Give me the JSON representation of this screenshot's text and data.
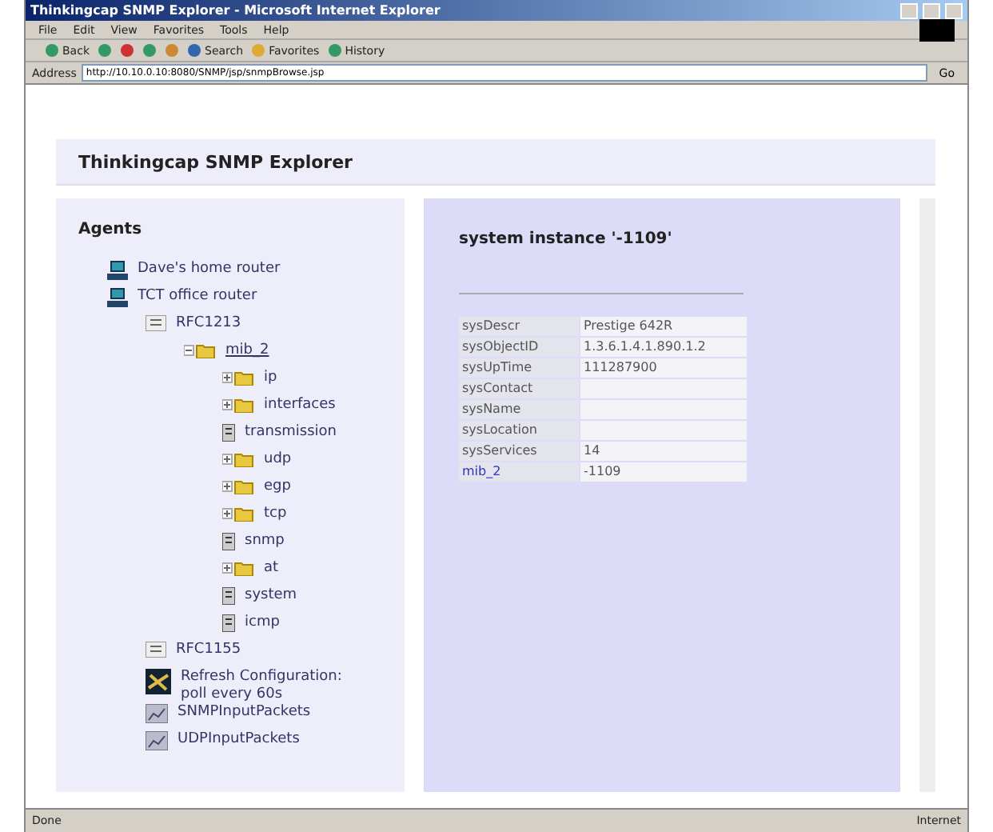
{
  "window": {
    "title": "Thinkingcap SNMP Explorer - Microsoft Internet Explorer"
  },
  "menu": [
    "File",
    "Edit",
    "View",
    "Favorites",
    "Tools",
    "Help"
  ],
  "toolbar": [
    {
      "kind": "back",
      "label": "Back"
    },
    {
      "kind": "forward"
    },
    {
      "kind": "stop"
    },
    {
      "kind": "refresh"
    },
    {
      "kind": "home"
    },
    {
      "kind": "search",
      "label": "Search"
    },
    {
      "kind": "favorites",
      "label": "Favorites"
    },
    {
      "kind": "history",
      "label": "History"
    }
  ],
  "address": {
    "label": "Address",
    "value": "http://10.10.0.10:8080/SNMP/jsp/snmpBrowse.jsp",
    "go": "Go"
  },
  "header": {
    "title": "Thinkingcap SNMP Explorer"
  },
  "agents": {
    "title": "Agents",
    "tree": [
      {
        "kind": "agent",
        "label": "Dave's home router"
      },
      {
        "kind": "agent",
        "label": "TCT office router",
        "children": [
          {
            "kind": "mib",
            "label": "RFC1213",
            "children": [
              {
                "kind": "folder",
                "label": "mib_2",
                "expanded": true,
                "children": [
                  {
                    "kind": "folder",
                    "label": "ip",
                    "expanded": false
                  },
                  {
                    "kind": "folder",
                    "label": "interfaces",
                    "expanded": false
                  },
                  {
                    "kind": "leaf",
                    "label": "transmission"
                  },
                  {
                    "kind": "folder",
                    "label": "udp",
                    "expanded": false
                  },
                  {
                    "kind": "folder",
                    "label": "egp",
                    "expanded": false
                  },
                  {
                    "kind": "folder",
                    "label": "tcp",
                    "expanded": false
                  },
                  {
                    "kind": "leaf",
                    "label": "snmp"
                  },
                  {
                    "kind": "folder",
                    "label": "at",
                    "expanded": false
                  },
                  {
                    "kind": "leaf",
                    "label": "system"
                  },
                  {
                    "kind": "leaf",
                    "label": "icmp"
                  }
                ]
              }
            ]
          },
          {
            "kind": "mib",
            "label": "RFC1155"
          },
          {
            "kind": "action",
            "label": "Refresh Configuration: poll every 60s"
          },
          {
            "kind": "graph",
            "label": "SNMPInputPackets"
          },
          {
            "kind": "graph",
            "label": "UDPInputPackets"
          }
        ]
      }
    ]
  },
  "detail": {
    "title": "system instance '-1109'",
    "rows": [
      {
        "name": "sysDescr",
        "value": "Prestige 642R",
        "link": false
      },
      {
        "name": "sysObjectID",
        "value": "1.3.6.1.4.1.890.1.2",
        "link": false
      },
      {
        "name": "sysUpTime",
        "value": "111287900",
        "link": false
      },
      {
        "name": "sysContact",
        "value": "",
        "link": false
      },
      {
        "name": "sysName",
        "value": "",
        "link": false
      },
      {
        "name": "sysLocation",
        "value": "",
        "link": false
      },
      {
        "name": "sysServices",
        "value": "14",
        "link": false
      },
      {
        "name": "mib_2",
        "value": "-1109",
        "link": true
      }
    ]
  },
  "status_bar": {
    "text": "Done",
    "zone": "Internet"
  }
}
